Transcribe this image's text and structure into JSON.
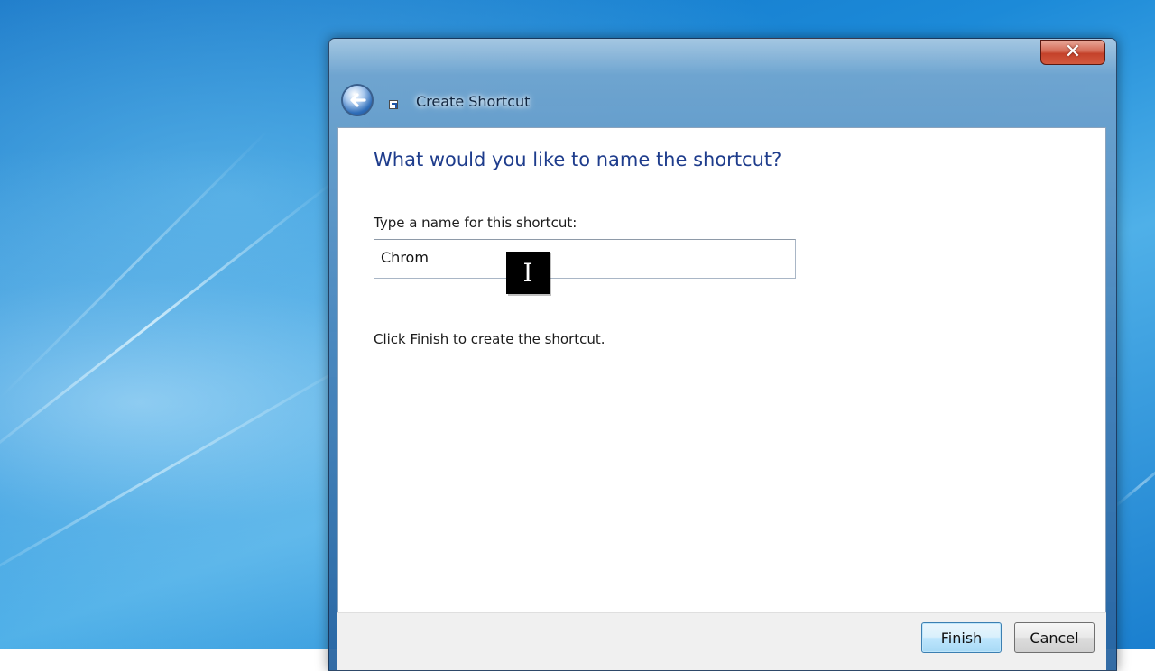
{
  "window": {
    "title": "Create Shortcut",
    "close_label": "✕"
  },
  "main": {
    "heading": "What would you like to name the shortcut?",
    "name_label": "Type a name for this shortcut:",
    "name_value": "Chrom",
    "hint": "Click Finish to create the shortcut."
  },
  "footer": {
    "finish_label": "Finish",
    "cancel_label": "Cancel"
  },
  "cursor": {
    "glyph": "I"
  }
}
